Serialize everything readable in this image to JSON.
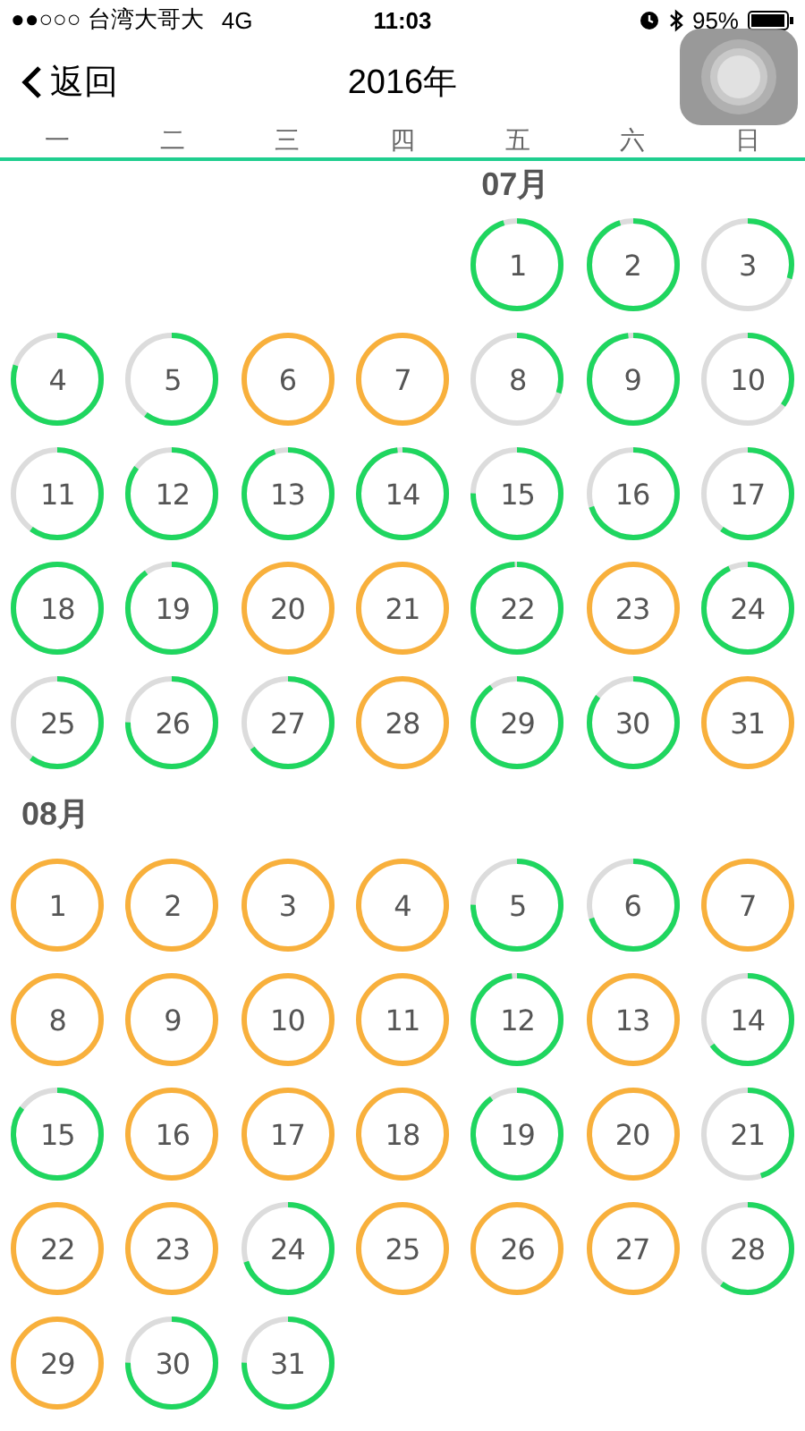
{
  "status_bar": {
    "carrier": "●●○○○ 台湾大哥大",
    "network": "4G",
    "time": "11:03",
    "battery": "95%"
  },
  "nav": {
    "back": "返回",
    "title": "2016年"
  },
  "weekdays": [
    "一",
    "二",
    "三",
    "四",
    "五",
    "六",
    "日"
  ],
  "months": [
    {
      "label": "07月",
      "days": [
        {
          "kind": "blank"
        },
        {
          "kind": "blank"
        },
        {
          "kind": "blank"
        },
        {
          "kind": "blank"
        },
        {
          "kind": "progress",
          "day": "1",
          "level": 0.95
        },
        {
          "kind": "progress",
          "day": "2",
          "level": 0.95
        },
        {
          "kind": "progress",
          "day": "3",
          "level": 0.3
        },
        {
          "kind": "progress",
          "day": "4",
          "level": 0.8
        },
        {
          "kind": "progress",
          "day": "5",
          "level": 0.6
        },
        {
          "kind": "goal",
          "day": "6"
        },
        {
          "kind": "goal",
          "day": "7"
        },
        {
          "kind": "progress",
          "day": "8",
          "level": 0.3
        },
        {
          "kind": "progress",
          "day": "9",
          "level": 0.98
        },
        {
          "kind": "progress",
          "day": "10",
          "level": 0.35
        },
        {
          "kind": "progress",
          "day": "11",
          "level": 0.6
        },
        {
          "kind": "progress",
          "day": "12",
          "level": 0.85
        },
        {
          "kind": "progress",
          "day": "13",
          "level": 0.95
        },
        {
          "kind": "progress",
          "day": "14",
          "level": 0.98
        },
        {
          "kind": "progress",
          "day": "15",
          "level": 0.75
        },
        {
          "kind": "progress",
          "day": "16",
          "level": 0.7
        },
        {
          "kind": "progress",
          "day": "17",
          "level": 0.6
        },
        {
          "kind": "progress",
          "day": "18",
          "level": 1
        },
        {
          "kind": "progress",
          "day": "19",
          "level": 0.9
        },
        {
          "kind": "goal",
          "day": "20"
        },
        {
          "kind": "goal",
          "day": "21"
        },
        {
          "kind": "progress",
          "day": "22",
          "level": 0.99
        },
        {
          "kind": "goal",
          "day": "23"
        },
        {
          "kind": "progress",
          "day": "24",
          "level": 0.93
        },
        {
          "kind": "progress",
          "day": "25",
          "level": 0.6
        },
        {
          "kind": "progress",
          "day": "26",
          "level": 0.75
        },
        {
          "kind": "progress",
          "day": "27",
          "level": 0.65
        },
        {
          "kind": "goal",
          "day": "28"
        },
        {
          "kind": "progress",
          "day": "29",
          "level": 0.9
        },
        {
          "kind": "progress",
          "day": "30",
          "level": 0.85
        },
        {
          "kind": "goal",
          "day": "31"
        }
      ]
    },
    {
      "label": "08月",
      "days": [
        {
          "kind": "goal",
          "day": "1"
        },
        {
          "kind": "goal",
          "day": "2"
        },
        {
          "kind": "goal",
          "day": "3"
        },
        {
          "kind": "goal",
          "day": "4"
        },
        {
          "kind": "progress",
          "day": "5",
          "level": 0.75
        },
        {
          "kind": "progress",
          "day": "6",
          "level": 0.7
        },
        {
          "kind": "goal",
          "day": "7"
        },
        {
          "kind": "goal",
          "day": "8"
        },
        {
          "kind": "goal",
          "day": "9"
        },
        {
          "kind": "goal",
          "day": "10"
        },
        {
          "kind": "goal",
          "day": "11"
        },
        {
          "kind": "progress",
          "day": "12",
          "level": 0.98
        },
        {
          "kind": "goal",
          "day": "13"
        },
        {
          "kind": "progress",
          "day": "14",
          "level": 0.65
        },
        {
          "kind": "progress",
          "day": "15",
          "level": 0.85
        },
        {
          "kind": "goal",
          "day": "16"
        },
        {
          "kind": "goal",
          "day": "17"
        },
        {
          "kind": "goal",
          "day": "18"
        },
        {
          "kind": "progress",
          "day": "19",
          "level": 0.9
        },
        {
          "kind": "goal",
          "day": "20"
        },
        {
          "kind": "progress",
          "day": "21",
          "level": 0.45
        },
        {
          "kind": "goal",
          "day": "22"
        },
        {
          "kind": "goal",
          "day": "23"
        },
        {
          "kind": "progress",
          "day": "24",
          "level": 0.7
        },
        {
          "kind": "goal",
          "day": "25"
        },
        {
          "kind": "goal",
          "day": "26"
        },
        {
          "kind": "goal",
          "day": "27"
        },
        {
          "kind": "progress",
          "day": "28",
          "level": 0.6
        },
        {
          "kind": "goal",
          "day": "29"
        },
        {
          "kind": "progress",
          "day": "30",
          "level": 0.75
        },
        {
          "kind": "progress",
          "day": "31",
          "level": 0.75
        }
      ]
    }
  ]
}
